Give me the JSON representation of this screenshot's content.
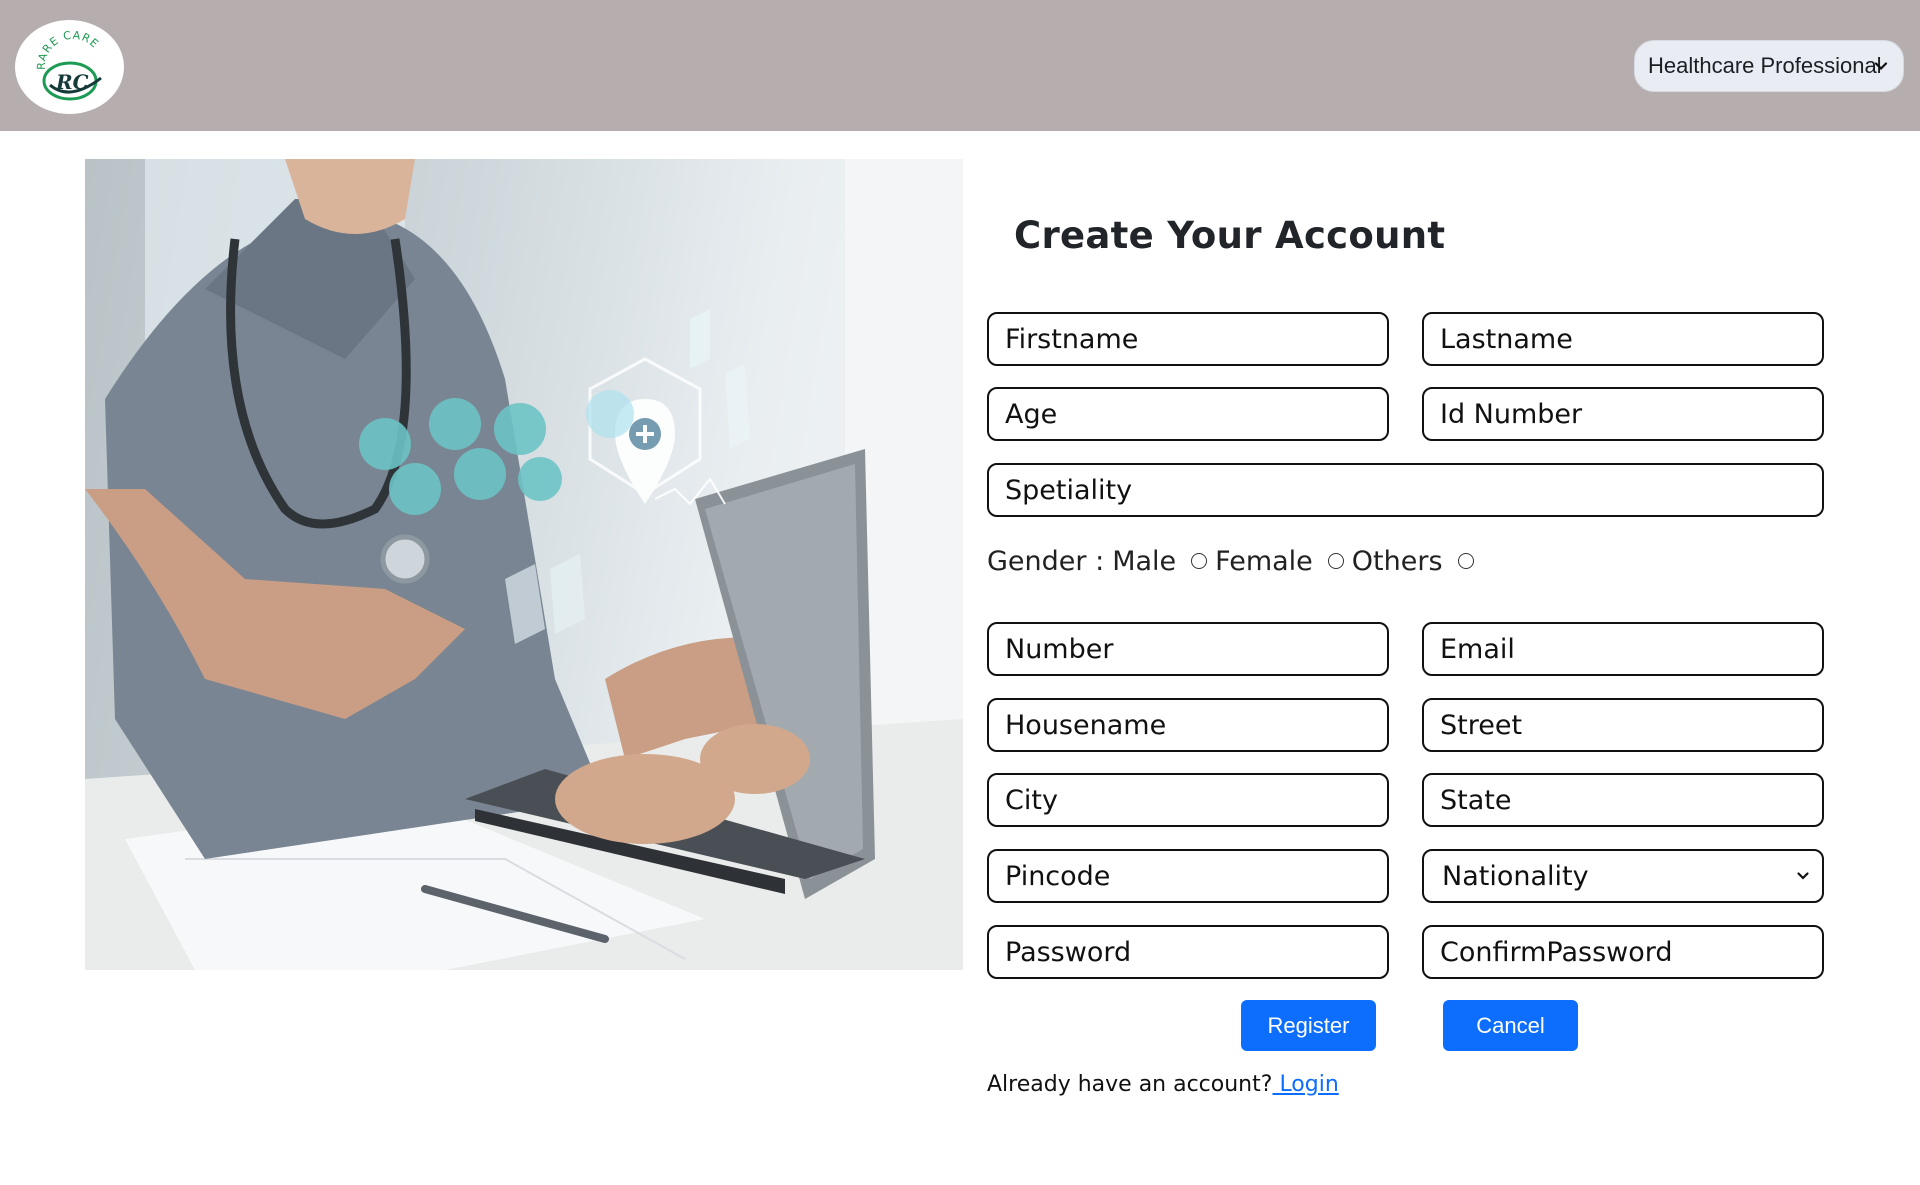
{
  "header": {
    "logo_text_top": "RARE CARE",
    "logo_monogram": "RC",
    "role_select_value": "Healthcare Professional"
  },
  "form": {
    "title": "Create Your Account",
    "placeholders": {
      "firstname": "Firstname",
      "lastname": "Lastname",
      "age": "Age",
      "id_number": "Id Number",
      "speciality": "Spetiality",
      "number": "Number",
      "email": "Email",
      "housename": "Housename",
      "street": "Street",
      "city": "City",
      "state": "State",
      "pincode": "Pincode",
      "password": "Password",
      "confirm_password": "ConfirmPassword"
    },
    "nationality_value": "Nationality",
    "gender": {
      "label": "Gender :",
      "options": [
        "Male",
        "Female",
        "Others"
      ]
    },
    "buttons": {
      "register": "Register",
      "cancel": "Cancel"
    },
    "login_prompt": "Already have an account?",
    "login_link": "Login"
  },
  "colors": {
    "header_bg": "#b6aeae",
    "primary": "#0d6efd"
  }
}
